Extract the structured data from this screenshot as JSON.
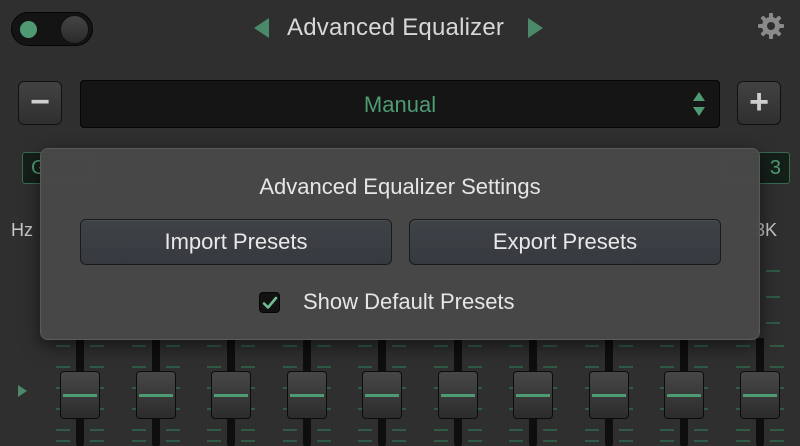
{
  "header": {
    "title": "Advanced Equalizer",
    "power_on": true
  },
  "preset_bar": {
    "minus_label": "−",
    "plus_label": "+",
    "selected_preset": "Manual"
  },
  "background_row": {
    "gain_left_visible": "G",
    "gain_right_visible": "3",
    "freq_left_label": "Hz",
    "freq_right_label": "3K"
  },
  "settings_popover": {
    "title": "Advanced Equalizer Settings",
    "import_label": "Import Presets",
    "export_label": "Export Presets",
    "show_default_label": "Show Default Presets",
    "show_default_checked": true
  },
  "equalizer": {
    "band_count": 10
  },
  "colors": {
    "accent": "#4e9b73",
    "background": "#2f2f2f",
    "popover": "#484848"
  }
}
